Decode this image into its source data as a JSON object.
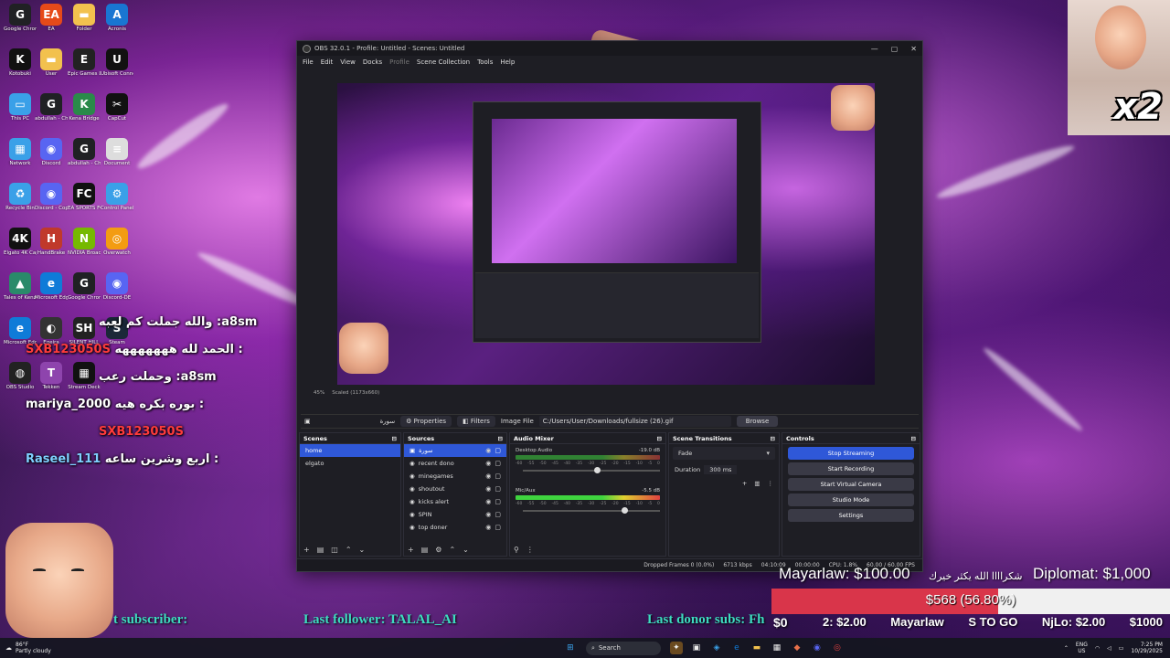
{
  "desktop": {
    "icons": [
      {
        "label": "Google Chrome",
        "icon": "chrome-icon",
        "color": "#202124",
        "glyph": "G"
      },
      {
        "label": "EA",
        "icon": "ea-icon",
        "color": "#e64a19",
        "glyph": "EA"
      },
      {
        "label": "Folder",
        "icon": "folder-icon",
        "color": "#f2c14e",
        "glyph": "▬"
      },
      {
        "label": "Acronis",
        "icon": "app-icon",
        "color": "#1976d2",
        "glyph": "A"
      },
      {
        "label": "Kotobuki",
        "icon": "app-icon",
        "color": "#111",
        "glyph": "K"
      },
      {
        "label": "User",
        "icon": "folder-icon",
        "color": "#f2c14e",
        "glyph": "▬"
      },
      {
        "label": "Epic Games Launcher",
        "icon": "epic-icon",
        "color": "#222",
        "glyph": "E"
      },
      {
        "label": "Ubisoft Connect",
        "icon": "ubisoft-icon",
        "color": "#111",
        "glyph": "U"
      },
      {
        "label": "This PC",
        "icon": "pc-icon",
        "color": "#3aa0e8",
        "glyph": "▭"
      },
      {
        "label": "abdullah - Chrome",
        "icon": "chrome-icon",
        "color": "#202124",
        "glyph": "G"
      },
      {
        "label": "Kena Bridge",
        "icon": "app-icon",
        "color": "#2a8a4a",
        "glyph": "K"
      },
      {
        "label": "CapCut",
        "icon": "capcut-icon",
        "color": "#111",
        "glyph": "✂"
      },
      {
        "label": "Network",
        "icon": "network-icon",
        "color": "#3aa0e8",
        "glyph": "▦"
      },
      {
        "label": "Discord",
        "icon": "discord-icon",
        "color": "#5865f2",
        "glyph": "◉"
      },
      {
        "label": "abdullah - Chrome (1)",
        "icon": "chrome-icon",
        "color": "#202124",
        "glyph": "G"
      },
      {
        "label": "Document",
        "icon": "file-icon",
        "color": "#ddd",
        "glyph": "≡"
      },
      {
        "label": "Recycle Bin",
        "icon": "recycle-bin-icon",
        "color": "#3aa0e8",
        "glyph": "♻"
      },
      {
        "label": "Discord - Copy",
        "icon": "discord-icon",
        "color": "#5865f2",
        "glyph": "◉"
      },
      {
        "label": "EA SPORTS FC 25",
        "icon": "app-icon",
        "color": "#111",
        "glyph": "FC"
      },
      {
        "label": "Control Panel",
        "icon": "control-panel-icon",
        "color": "#3aa0e8",
        "glyph": "⚙"
      },
      {
        "label": "Elgato 4K Capture",
        "icon": "app-icon",
        "color": "#111",
        "glyph": "4K"
      },
      {
        "label": "HandBrake",
        "icon": "app-icon",
        "color": "#c0392b",
        "glyph": "H"
      },
      {
        "label": "NVIDIA Broadcast",
        "icon": "nvidia-icon",
        "color": "#76b900",
        "glyph": "N"
      },
      {
        "label": "Overwatch",
        "icon": "app-icon",
        "color": "#f39c12",
        "glyph": "◎"
      },
      {
        "label": "Tales of Kenzera ZAU",
        "icon": "app-icon",
        "color": "#2a8a6a",
        "glyph": "▲"
      },
      {
        "label": "Microsoft Edge",
        "icon": "edge-icon",
        "color": "#0f7bd8",
        "glyph": "e"
      },
      {
        "label": "Google Chrome",
        "icon": "chrome-icon",
        "color": "#202124",
        "glyph": "G"
      },
      {
        "label": "Discord-DE",
        "icon": "discord-icon",
        "color": "#5865f2",
        "glyph": "◉"
      },
      {
        "label": "Microsoft Edge",
        "icon": "edge-icon",
        "color": "#0f7bd8",
        "glyph": "e"
      },
      {
        "label": "Egeira",
        "icon": "app-icon",
        "color": "#333",
        "glyph": "◐"
      },
      {
        "label": "SILENT HILL",
        "icon": "app-icon",
        "color": "#222",
        "glyph": "SH"
      },
      {
        "label": "Steam",
        "icon": "steam-icon",
        "color": "#1b2838",
        "glyph": "S"
      },
      {
        "label": "OBS Studio",
        "icon": "obs-icon",
        "color": "#222",
        "glyph": "◍"
      },
      {
        "label": "Tekken",
        "icon": "app-icon",
        "color": "#8e44ad",
        "glyph": "T"
      },
      {
        "label": "Stream Deck",
        "icon": "app-icon",
        "color": "#111",
        "glyph": "▦"
      }
    ]
  },
  "chat": [
    {
      "name": "a8sm",
      "text": "والله جملت كم لعبه :",
      "color": "#ffffff",
      "name_color": "#ffffff"
    },
    {
      "name": "SXB123050S",
      "text": "الحمد لله هههههههه :",
      "color": "#ffffff",
      "name_color": "#ff3b3b"
    },
    {
      "name": "a8sm",
      "text": "وحملت رعب :",
      "color": "#ffffff",
      "name_color": "#ffffff"
    },
    {
      "name": "mariya_2000",
      "text": "بوره بكره هيه :",
      "color": "#ffffff",
      "name_color": "#ffffff"
    },
    {
      "name": "SXB123050S",
      "text": "",
      "color": "#ffffff",
      "name_color": "#ff3b3b"
    },
    {
      "name": "Raseel_111",
      "text": "اربع وشرين ساعه :",
      "color": "#ffffff",
      "name_color": "#7fd0ff"
    }
  ],
  "obs": {
    "title": "OBS 32.0.1 - Profile: Untitled - Scenes: Untitled",
    "menu": [
      "File",
      "Edit",
      "View",
      "Docks",
      "Profile",
      "Scene Collection",
      "Tools",
      "Help"
    ],
    "preview_status": "Scaled (1173x660)",
    "zoom": "45%",
    "property_bar": {
      "source_name": "سورة",
      "properties_label": "Properties",
      "filters_label": "Filters",
      "image_file_label": "Image File",
      "path": "C:/Users/User/Downloads/fullsize (26).gif",
      "browse_label": "Browse"
    },
    "scenes": {
      "title": "Scenes",
      "items": [
        "home",
        "elgato"
      ]
    },
    "sources": {
      "title": "Sources",
      "items": [
        "سورة",
        "recent dono",
        "minegames",
        "shoutout",
        "kicks alert",
        "SPIN",
        "top doner"
      ]
    },
    "mixer": {
      "title": "Audio Mixer",
      "channels": [
        {
          "name": "Desktop Audio",
          "db": "-19.0 dB"
        },
        {
          "name": "Mic/Aux",
          "db": "-5.5 dB"
        }
      ],
      "scale": [
        "-60",
        "-55",
        "-50",
        "-45",
        "-40",
        "-35",
        "-30",
        "-25",
        "-20",
        "-15",
        "-10",
        "-5",
        "0"
      ]
    },
    "transitions": {
      "title": "Scene Transitions",
      "type": "Fade",
      "duration_label": "Duration",
      "duration": "300 ms"
    },
    "controls": {
      "title": "Controls",
      "buttons": [
        "Stop Streaming",
        "Start Recording",
        "Start Virtual Camera",
        "Studio Mode",
        "Settings"
      ]
    },
    "status": {
      "dropped": "Dropped Frames 0 (0.0%)",
      "bitrate": "6713 kbps",
      "live_time": "04:10:09",
      "rec_time": "00:00:00",
      "cpu": "CPU: 1.8%",
      "fps": "60.00 / 60.00 FPS"
    }
  },
  "overlay": {
    "donor_right_1": "Mayarlaw: $100.00",
    "donor_arabic": "شكراااا الله يكثر خيرك",
    "donor_right_2": "Diplomat: $1,000",
    "goal_label": "$568 (56.80%)",
    "goal_percent": 56.8,
    "goal_left": "$0",
    "ticker_subscriber": "t subscriber:",
    "ticker_follower": "Last follower: TALAL_AI",
    "ticker_donor": "Last donor subs: Fh",
    "donations_row": [
      "2: $2.00",
      "Mayarlaw",
      "S TO GO",
      "NjLo: $2.00",
      "$1000"
    ],
    "cam_badge": "x2"
  },
  "taskbar": {
    "weather_temp": "86°F",
    "weather_text": "Partly cloudy",
    "search_placeholder": "Search",
    "lang": "ENG",
    "region": "US",
    "time": "7:25 PM",
    "date": "10/29/2025"
  },
  "colors": {
    "obs_bg": "#1e1e24",
    "accent_blue": "#2f58d8",
    "goal_red": "#d9354a",
    "ticker_teal": "#3ddcc0"
  }
}
